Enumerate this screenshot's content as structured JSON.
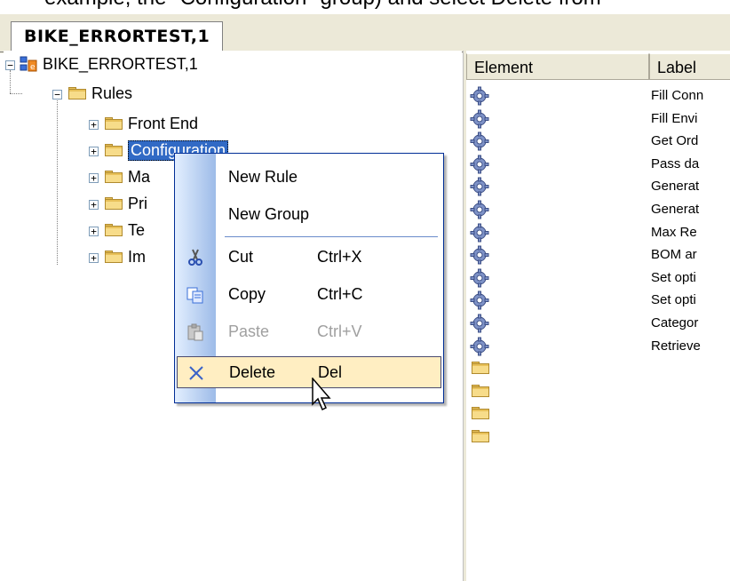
{
  "caption_fragment": "example, the \"Configuration\" group) and select Delete from",
  "tab": {
    "label": "BIKE_ERRORTEST,1"
  },
  "tree": {
    "root": {
      "label": "BIKE_ERRORTEST,1"
    },
    "rules": {
      "label": "Rules"
    },
    "children": [
      {
        "label": "Front End"
      },
      {
        "label": "Configuration"
      },
      {
        "label": "Ma"
      },
      {
        "label": "Pri"
      },
      {
        "label": "Te"
      },
      {
        "label": "Im"
      }
    ]
  },
  "list": {
    "columns": [
      "Element",
      "Label"
    ],
    "rows": [
      {
        "label": "Fill Conn"
      },
      {
        "label": "Fill Envi"
      },
      {
        "label": "Get Ord"
      },
      {
        "label": "Pass da"
      },
      {
        "label": "Generat"
      },
      {
        "label": "Generat"
      },
      {
        "label": "Max Re"
      },
      {
        "label": "BOM ar"
      },
      {
        "label": "Set opti"
      },
      {
        "label": "Set opti"
      },
      {
        "label": "Categor"
      },
      {
        "label": "Retrieve"
      }
    ],
    "folder_rows": 4
  },
  "context_menu": {
    "items": [
      {
        "label": "New Rule",
        "shortcut": "",
        "icon": "none"
      },
      {
        "label": "New Group",
        "shortcut": "",
        "icon": "none"
      },
      {
        "label": "Cut",
        "shortcut": "Ctrl+X",
        "icon": "scissors-icon"
      },
      {
        "label": "Copy",
        "shortcut": "Ctrl+C",
        "icon": "copy-icon"
      },
      {
        "label": "Paste",
        "shortcut": "Ctrl+V",
        "icon": "paste-icon",
        "disabled": true
      },
      {
        "label": "Delete",
        "shortcut": "Del",
        "icon": "delete-x-icon",
        "highlighted": true
      }
    ]
  },
  "colors": {
    "selection": "#316ac5",
    "menu_hover": "#ffeec2",
    "menu_border": "#002d96",
    "window_bg": "#ece9d8"
  }
}
